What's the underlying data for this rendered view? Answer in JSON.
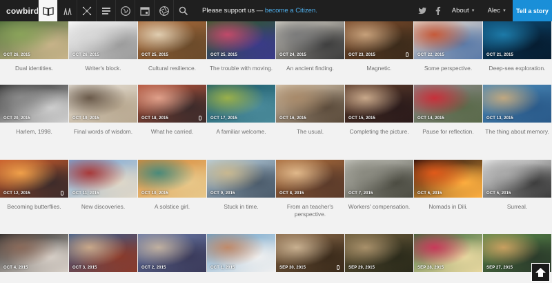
{
  "app": {
    "logo": "cowbird"
  },
  "nav": {
    "icons": [
      "open-book-icon",
      "walking-people-icon",
      "network-graph-icon",
      "seeds-text-icon",
      "globe-icon",
      "calendar-icon",
      "aperture-icon",
      "search-icon"
    ],
    "support_text": "Please support us — ",
    "support_link": "become a Citizen.",
    "about": "About",
    "user": "Alec",
    "tell_button": "Tell a story",
    "social": [
      "twitter-icon",
      "facebook-icon"
    ]
  },
  "colors": {
    "bar": "#1f1f1f",
    "accent": "#1a8fd8",
    "link": "#4fb2f0",
    "page_bg": "#f2f2f2"
  },
  "stories": [
    {
      "date": "OCT 26, 2015",
      "caption": "Dual identities.",
      "mic": false,
      "palette": [
        "#4e6b3a",
        "#8aa35a",
        "#c9b48a"
      ]
    },
    {
      "date": "OCT 26, 2015",
      "caption": "Writer's block.",
      "mic": false,
      "palette": [
        "#ffffff",
        "#d8d8d8",
        "#9a9a9a"
      ]
    },
    {
      "date": "OCT 25, 2015",
      "caption": "Cultural resilience.",
      "mic": false,
      "palette": [
        "#a86a3a",
        "#e0cdb0",
        "#6a4a2a"
      ]
    },
    {
      "date": "OCT 25, 2015",
      "caption": "The trouble with moving.",
      "mic": false,
      "palette": [
        "#2f5a2a",
        "#c04a6a",
        "#3a3a8a"
      ]
    },
    {
      "date": "OCT 24, 2015",
      "caption": "An ancient finding.",
      "mic": false,
      "palette": [
        "#d6d2c8",
        "#7b7b7b",
        "#3c3c3c"
      ]
    },
    {
      "date": "OCT 23, 2015",
      "caption": "Magnetic.",
      "mic": true,
      "palette": [
        "#7a4a2a",
        "#c6a07a",
        "#3a2a1a"
      ]
    },
    {
      "date": "OCT 22, 2015",
      "caption": "Some perspective.",
      "mic": false,
      "palette": [
        "#e7dcd0",
        "#c65a3a",
        "#5a7aa8"
      ]
    },
    {
      "date": "OCT 21, 2015",
      "caption": "Deep-sea exploration.",
      "mic": false,
      "palette": [
        "#0d4a72",
        "#1d7aa8",
        "#061c30"
      ]
    },
    {
      "date": "OCT 20, 2015",
      "caption": "Harlem, 1998.",
      "mic": false,
      "palette": [
        "#2a2a2a",
        "#8a8a8a",
        "#d0d0d0"
      ]
    },
    {
      "date": "OCT 19, 2015",
      "caption": "Final words of wisdom.",
      "mic": false,
      "palette": [
        "#e8e2d8",
        "#6a5a4a",
        "#b8a890"
      ]
    },
    {
      "date": "OCT 18, 2015",
      "caption": "What he carried.",
      "mic": true,
      "palette": [
        "#b5533a",
        "#e0a08a",
        "#3a2a2a"
      ]
    },
    {
      "date": "OCT 17, 2015",
      "caption": "A familiar welcome.",
      "mic": false,
      "palette": [
        "#1a5a6a",
        "#9ab04a",
        "#4a8a9a"
      ]
    },
    {
      "date": "OCT 16, 2015",
      "caption": "The usual.",
      "mic": false,
      "palette": [
        "#d9c8b0",
        "#a88a6a",
        "#5a4a3a"
      ]
    },
    {
      "date": "OCT 15, 2015",
      "caption": "Completing the picture.",
      "mic": false,
      "palette": [
        "#5a3a2a",
        "#c8a88a",
        "#2a1a1a"
      ]
    },
    {
      "date": "OCT 14, 2015",
      "caption": "Pause for reflection.",
      "mic": false,
      "palette": [
        "#8a8a8a",
        "#c8303a",
        "#5a6a4a"
      ]
    },
    {
      "date": "OCT 13, 2015",
      "caption": "The thing about memory.",
      "mic": false,
      "palette": [
        "#4a8ab8",
        "#c0a880",
        "#2a5a8a"
      ]
    },
    {
      "date": "OCT 12, 2015",
      "caption": "Becoming butterflies.",
      "mic": true,
      "palette": [
        "#c85a2a",
        "#f0a04a",
        "#3a2a2a"
      ]
    },
    {
      "date": "OCT 11, 2015",
      "caption": "New discoveries.",
      "mic": false,
      "palette": [
        "#7aa8d8",
        "#a83a3a",
        "#e0d8c8"
      ]
    },
    {
      "date": "OCT 10, 2015",
      "caption": "A solstice girl.",
      "mic": false,
      "palette": [
        "#d88a3a",
        "#4a8a7a",
        "#e8c88a"
      ]
    },
    {
      "date": "OCT 9, 2015",
      "caption": "Stuck in time.",
      "mic": false,
      "palette": [
        "#b8d0e0",
        "#c8b890",
        "#4a5a6a"
      ]
    },
    {
      "date": "OCT 8, 2015",
      "caption": "From an teacher's perspective.",
      "mic": false,
      "palette": [
        "#a86a3a",
        "#e0b88a",
        "#5a3a2a"
      ]
    },
    {
      "date": "OCT 7, 2015",
      "caption": "Workers' compensation.",
      "mic": false,
      "palette": [
        "#c8c8c0",
        "#8a8a80",
        "#4a4a40"
      ]
    },
    {
      "date": "OCT 6, 2015",
      "caption": "Nomads in Dili.",
      "mic": false,
      "palette": [
        "#1a0a0a",
        "#e05a1a",
        "#ffb040"
      ]
    },
    {
      "date": "OCT 5, 2015",
      "caption": "Surreal.",
      "mic": false,
      "palette": [
        "#f0f0f0",
        "#aaaaaa",
        "#3a3a3a"
      ]
    },
    {
      "date": "OCT 4, 2015",
      "caption": "",
      "mic": false,
      "palette": [
        "#2a2a2a",
        "#8a6a5a",
        "#d8d0c8"
      ]
    },
    {
      "date": "OCT 3, 2015",
      "caption": "",
      "mic": false,
      "palette": [
        "#3a5a8a",
        "#c8a88a",
        "#8a3a2a"
      ]
    },
    {
      "date": "OCT 2, 2015",
      "caption": "",
      "mic": false,
      "palette": [
        "#6a7aa8",
        "#c0b0a0",
        "#3a3a5a"
      ]
    },
    {
      "date": "OCT 1, 2015",
      "caption": "",
      "mic": false,
      "palette": [
        "#6aa0c8",
        "#c08a6a",
        "#f0f0f0"
      ]
    },
    {
      "date": "SEP 30, 2015",
      "caption": "",
      "mic": true,
      "palette": [
        "#8a6a4a",
        "#c8b090",
        "#3a2a1a"
      ]
    },
    {
      "date": "SEP 29, 2015",
      "caption": "",
      "mic": false,
      "palette": [
        "#6a5a3a",
        "#a8906a",
        "#2a2a1a"
      ]
    },
    {
      "date": "SEP 28, 2015",
      "caption": "",
      "mic": false,
      "palette": [
        "#3a6a3a",
        "#c83a5a",
        "#e8d8a0"
      ]
    },
    {
      "date": "SEP 27, 2015",
      "caption": "",
      "mic": false,
      "palette": [
        "#5a8a4a",
        "#c8a060",
        "#2a3a2a"
      ]
    }
  ]
}
